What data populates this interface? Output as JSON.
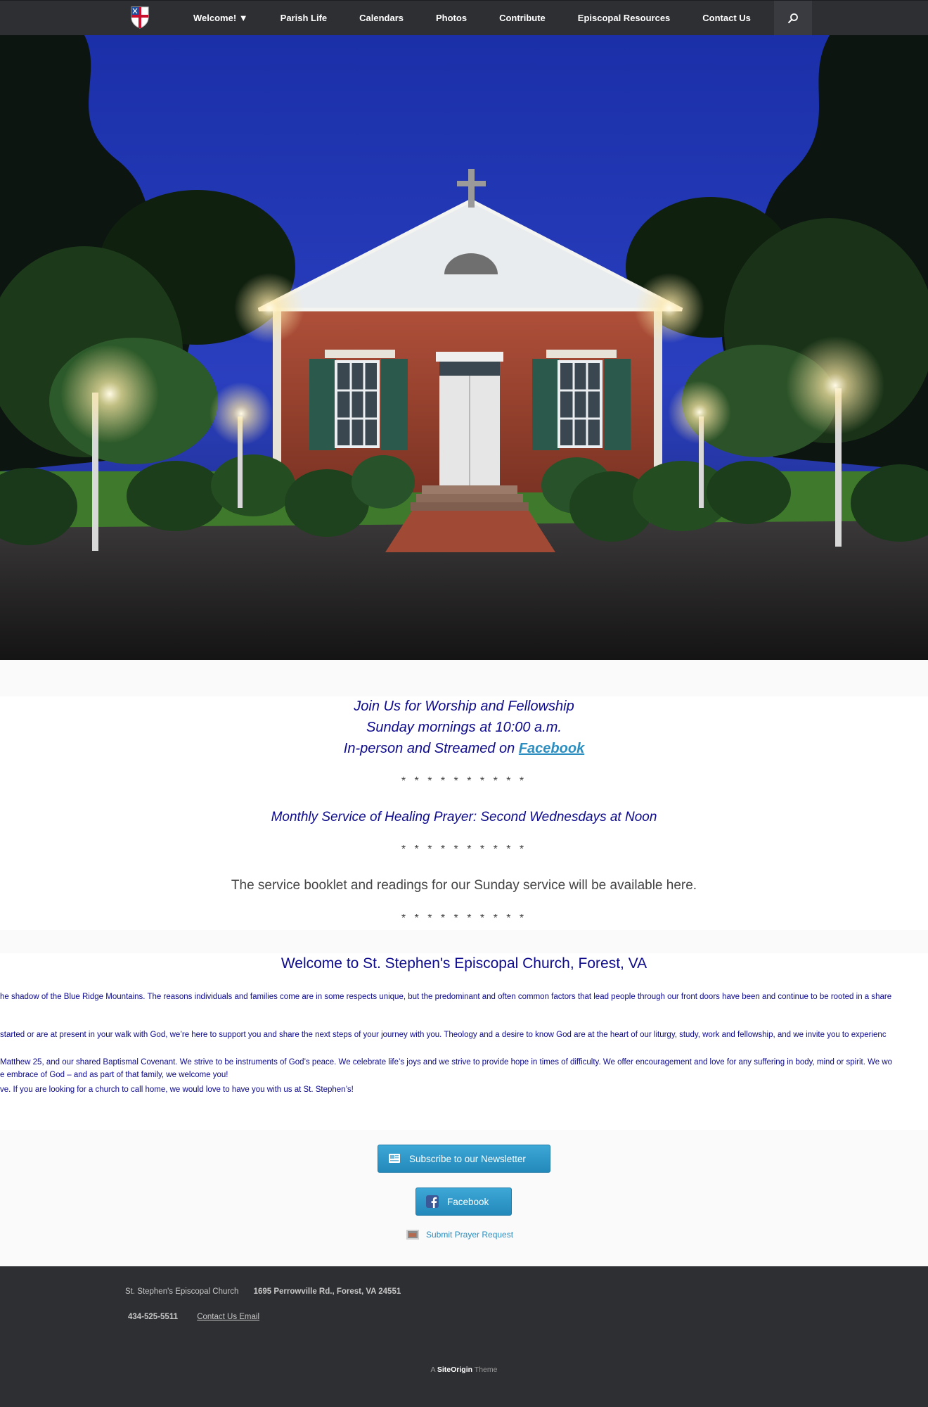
{
  "nav": {
    "logo": "episcopal-shield-logo",
    "items": [
      {
        "label": "Welcome! ▼"
      },
      {
        "label": "Parish Life"
      },
      {
        "label": "Calendars"
      },
      {
        "label": "Photos"
      },
      {
        "label": "Contribute"
      },
      {
        "label": "Episcopal Resources"
      },
      {
        "label": "Contact Us"
      }
    ],
    "search_icon": "search-icon"
  },
  "hero": {
    "image": "church-at-night-photo"
  },
  "worship": {
    "line1": "Join Us for Worship and Fellowship",
    "line2": "Sunday mornings at 10:00 a.m.",
    "line3_prefix": "In-person and Streamed on ",
    "line3_link": "Facebook",
    "divider": "* * * * * * * * * *",
    "healing": "Monthly Service of Healing Prayer: Second Wednesdays at Noon",
    "booklet": "The service booklet and readings for our Sunday service will be available here."
  },
  "welcome": {
    "title": "Welcome to St. Stephen's Episcopal Church, Forest, VA",
    "p1": "he shadow of the Blue Ridge Mountains. The reasons individuals and families come are in some respects unique, but the predominant and often common factors that lead people through our front doors have been and continue to be rooted in a share",
    "p2": "started or are at present in your walk with God, we’re here to support you and share the next steps of your journey with you. Theology and a desire to know God are at the heart of our liturgy, study, work and fellowship, and we invite you to experienc",
    "p3a": "Matthew 25, and our shared Baptismal Covenant. We strive to be instruments of God’s peace. We celebrate life’s joys and we strive to provide hope in times of difficulty. We offer encouragement and love for any suffering in body, mind or spirit. We wo",
    "p3b": "e embrace of God – and as part of that family, we welcome you!",
    "p4": "ve. If you are looking for a church to call home, we would love to have you with us at St. Stephen’s!"
  },
  "buttons": {
    "newsletter": "Subscribe to our Newsletter",
    "facebook": "Facebook",
    "prayer": "Submit Prayer Request"
  },
  "footer": {
    "church": "St. Stephen's Episcopal Church",
    "address": "1695 Perrowville Rd., Forest, VA  24551",
    "phone": "434-525-5511",
    "email_link": "Contact Us Email",
    "credit_prefix": "A ",
    "credit_brand": "SiteOrigin",
    "credit_suffix": " Theme"
  },
  "colors": {
    "nav_bg": "#2e2f33",
    "heading_blue": "#0d0a8c",
    "link_blue": "#2c8ec0",
    "button_blue": "#2389bb"
  }
}
